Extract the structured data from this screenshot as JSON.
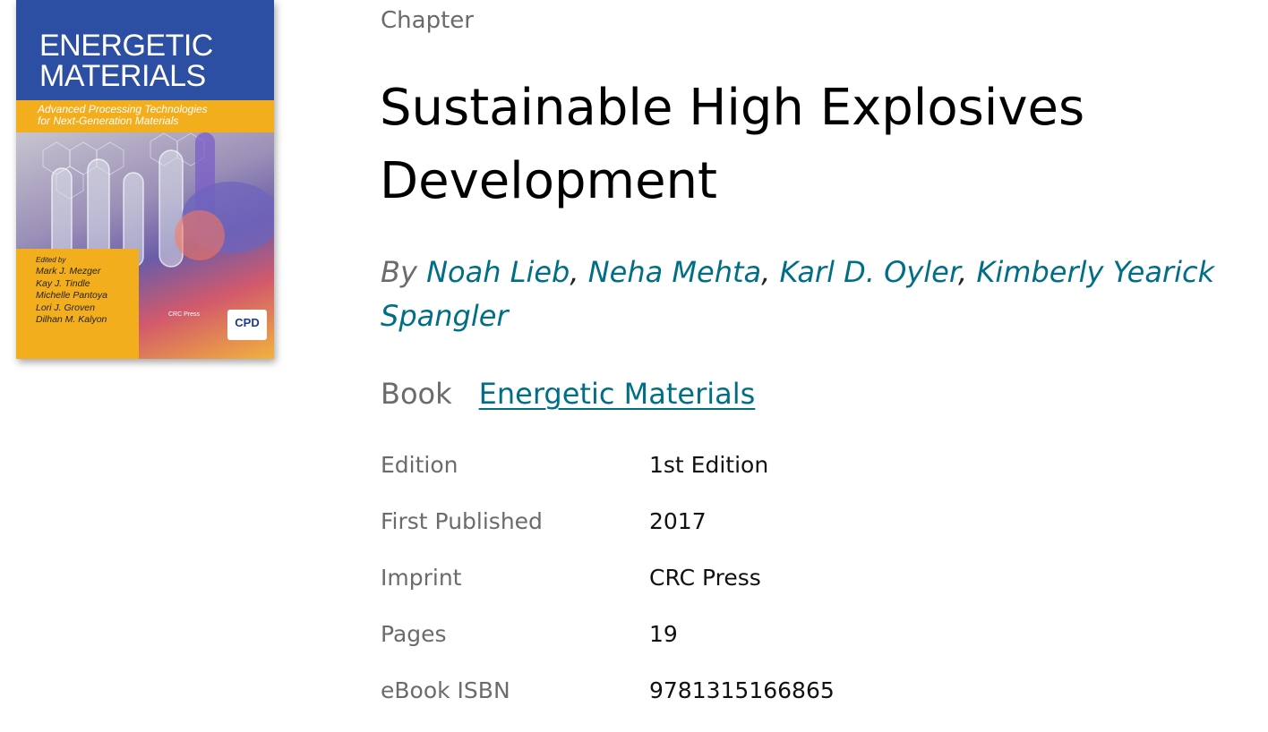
{
  "cover": {
    "title": "ENERGETIC\nMATERIALS",
    "subtitle": "Advanced Processing Technologies\nfor Next-Generation Materials",
    "editors_label": "Edited by",
    "editors": [
      "Mark J. Mezger",
      "Kay J. Tindle",
      "Michelle Pantoya",
      "Lori J. Groven",
      "Dilhan M. Kalyon"
    ],
    "publisher_logo": "CRC Press",
    "badge": "CPD",
    "colors": {
      "blue": "#2d4fa3",
      "gold": "#f2ae1c"
    }
  },
  "chapter": {
    "type_label": "Chapter",
    "title": "Sustainable High Explosives Development",
    "by_label": "By",
    "authors": [
      "Noah Lieb",
      "Neha Mehta",
      "Karl D. Oyler",
      "Kimberly Yearick Spangler"
    ]
  },
  "book": {
    "label": "Book",
    "title": "Energetic Materials"
  },
  "meta": [
    {
      "key": "Edition",
      "value": "1st Edition"
    },
    {
      "key": "First Published",
      "value": "2017"
    },
    {
      "key": "Imprint",
      "value": "CRC Press"
    },
    {
      "key": "Pages",
      "value": "19"
    },
    {
      "key": "eBook ISBN",
      "value": "9781315166865"
    }
  ],
  "colors": {
    "link": "#006f86",
    "muted": "#6b6b6b",
    "text": "#000000"
  }
}
